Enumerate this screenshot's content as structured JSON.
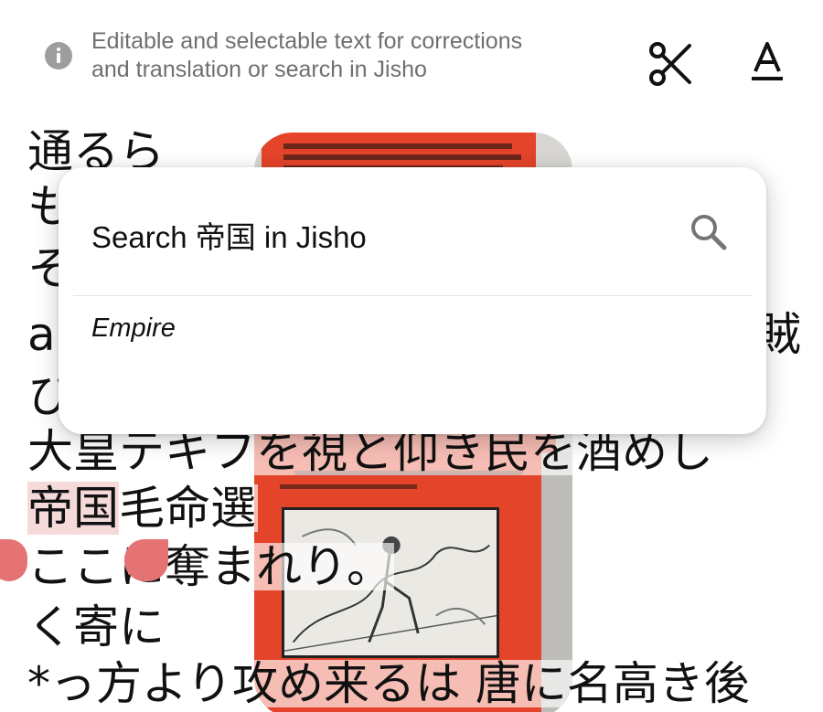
{
  "header": {
    "info_line1": "Editable and selectable text for corrections",
    "info_line2": "and translation or search in Jisho",
    "icons": {
      "info": "info-icon",
      "cut": "scissors-icon",
      "text_style": "font-icon"
    }
  },
  "ocr_lines": [
    "通るら",
    "も",
    "そ",
    "a",
    "ひ",
    "大皇テキフを視と仰き民を酒めし",
    "帝国毛命選",
    "ここに奪まれり。",
    "く寄に",
    "*っ方より攻め来るは 唐に名高き後"
  ],
  "ocr_right_fragment": "賊",
  "selection": {
    "text": "帝国"
  },
  "popup": {
    "search_label": "Search 帝国 in Jisho",
    "translation": "Empire",
    "search_icon": "search-icon"
  },
  "colors": {
    "selection_handle": "#e57373",
    "selection_highlight": "#f6dada",
    "photo_red": "#e4442a",
    "info_text": "#6f6f6f"
  }
}
